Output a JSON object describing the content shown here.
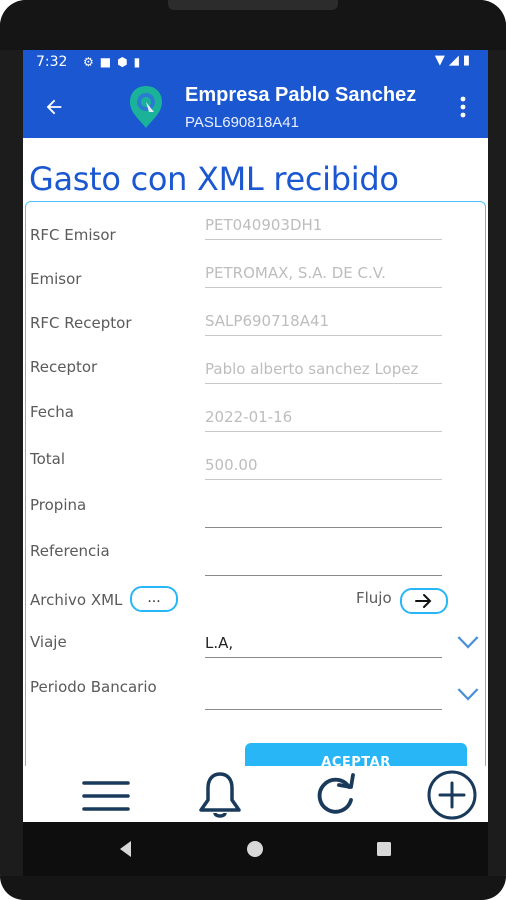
{
  "status_bar": {
    "time": "7:32",
    "left_icons": [
      "settings-icon",
      "sd-card-icon",
      "shield-icon",
      "sim-icon"
    ],
    "right_icons": [
      "wifi-icon",
      "signal-icon",
      "battery-icon"
    ]
  },
  "app_bar": {
    "company_name": "Empresa Pablo Sanchez",
    "company_rfc": "PASL690818A41",
    "back_icon": "arrow-back-icon",
    "menu_icon": "more-vert-icon"
  },
  "page": {
    "title": "Gasto con XML recibido"
  },
  "form": {
    "fields": [
      {
        "label": "RFC Emisor",
        "value": "PET040903DH1"
      },
      {
        "label": "Emisor",
        "value": "PETROMAX, S.A. DE C.V."
      },
      {
        "label": "RFC Receptor",
        "value": "SALP690718A41"
      },
      {
        "label": "Receptor",
        "value": "Pablo alberto sanchez Lopez"
      },
      {
        "label": "Fecha",
        "value": "2022-01-16"
      },
      {
        "label": "Total",
        "value": "500.00"
      },
      {
        "label": "Propina",
        "value": ""
      },
      {
        "label": "Referencia",
        "value": ""
      }
    ],
    "archivo_xml": {
      "label": "Archivo XML",
      "button_label": "..."
    },
    "flujo": {
      "label": "Flujo",
      "button_icon": "arrow-right-icon"
    },
    "viaje": {
      "label": "Viaje",
      "value": "L.A,"
    },
    "periodo_bancario": {
      "label": "Periodo Bancario",
      "value": ""
    },
    "accept_label": "ACEPTAR"
  },
  "bottom_nav": {
    "items": [
      "menu-icon",
      "bell-icon",
      "refresh-icon",
      "add-circle-icon"
    ]
  },
  "colors": {
    "primary": "#1a57d1",
    "accent": "#29b6f6",
    "title": "#1a57d1"
  }
}
